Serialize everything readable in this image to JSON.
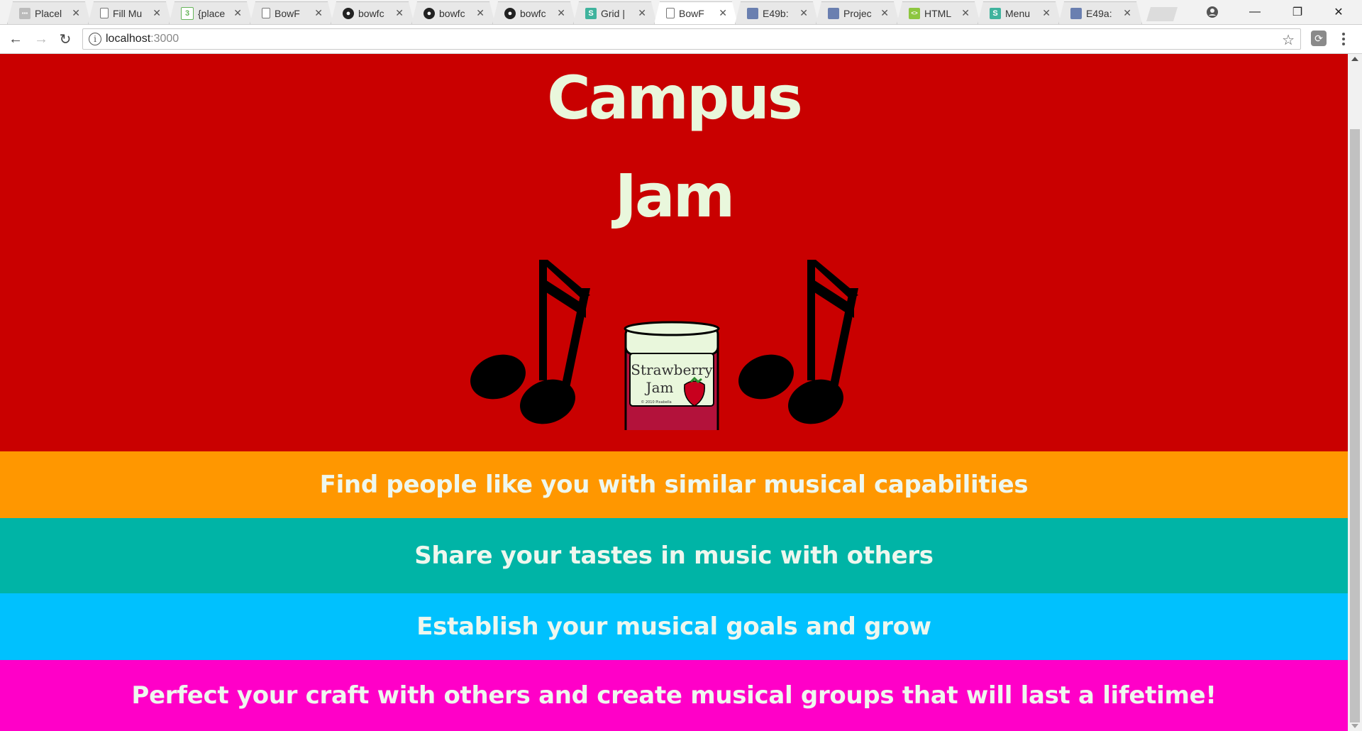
{
  "browser": {
    "tabs": [
      {
        "label": "Placel",
        "icon": "placeholder-site-icon",
        "active": false
      },
      {
        "label": "Fill Mu",
        "icon": "document-icon",
        "active": false
      },
      {
        "label": "{place",
        "icon": "green-s-icon",
        "active": false
      },
      {
        "label": "BowF",
        "icon": "document-icon",
        "active": false
      },
      {
        "label": "bowfc",
        "icon": "github-icon",
        "active": false
      },
      {
        "label": "bowfc",
        "icon": "github-icon",
        "active": false
      },
      {
        "label": "bowfc",
        "icon": "github-icon",
        "active": false
      },
      {
        "label": "Grid |",
        "icon": "s-brand-icon",
        "active": false
      },
      {
        "label": "BowF",
        "icon": "document-icon",
        "active": true
      },
      {
        "label": "E49b:",
        "icon": "blue-square-icon",
        "active": false
      },
      {
        "label": "Projec",
        "icon": "blue-square-icon",
        "active": false
      },
      {
        "label": "HTML",
        "icon": "html-icon",
        "active": false
      },
      {
        "label": "Menu",
        "icon": "s-brand-icon",
        "active": false
      },
      {
        "label": "E49a:",
        "icon": "blue-square-icon",
        "active": false
      }
    ],
    "address": {
      "host": "localhost",
      "port": ":3000"
    }
  },
  "hero": {
    "title_line1": "Campus",
    "title_line2": "Jam",
    "jar_label_line1": "Strawberry",
    "jar_label_line2": "Jam",
    "jar_copyright": "© 2010 Pixabella"
  },
  "features": [
    {
      "text": "Find people like you with similar musical capabilities",
      "color": "#ff9700"
    },
    {
      "text": "Share your tastes in music with others",
      "color": "#00b4a6"
    },
    {
      "text": "Establish your musical goals and grow",
      "color": "#00c1fe"
    },
    {
      "text": "Perfect your craft with others and create musical groups that will last a lifetime!",
      "color": "#ff00c8"
    }
  ],
  "colors": {
    "hero_bg": "#c90000",
    "title_text": "#e9f7dc"
  }
}
